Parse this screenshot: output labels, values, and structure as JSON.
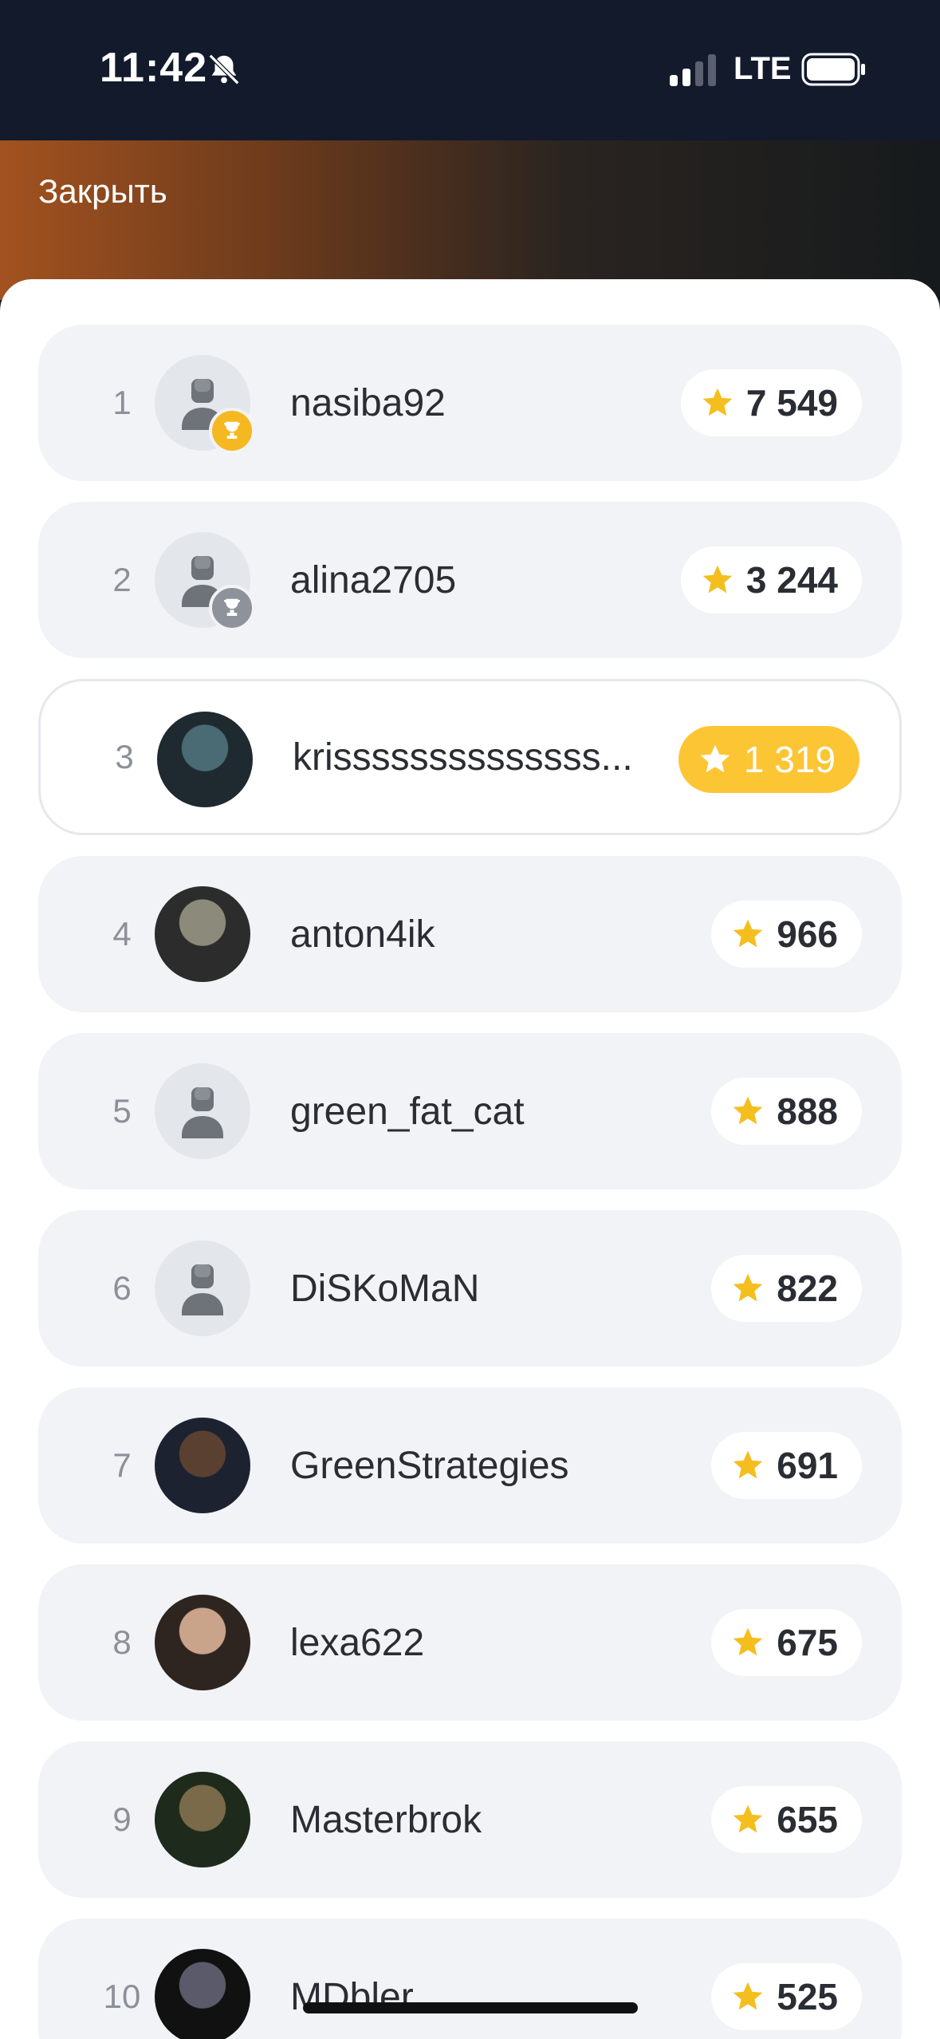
{
  "status": {
    "time": "11:42",
    "network": "LTE"
  },
  "header": {
    "close_label": "Закрыть"
  },
  "leaderboard": [
    {
      "rank": "1",
      "name": "nasiba92",
      "score": "7 549",
      "avatar": "placeholder",
      "badge": "gold-trophy"
    },
    {
      "rank": "2",
      "name": "alina2705",
      "score": "3 244",
      "avatar": "placeholder",
      "badge": "silver-trophy"
    },
    {
      "rank": "3",
      "name": "krissssssssssssss...",
      "score": "1 319",
      "avatar": "photo",
      "highlight": true
    },
    {
      "rank": "4",
      "name": "anton4ik",
      "score": "966",
      "avatar": "photo"
    },
    {
      "rank": "5",
      "name": "green_fat_cat",
      "score": "888",
      "avatar": "placeholder"
    },
    {
      "rank": "6",
      "name": "DiSKoMaN",
      "score": "822",
      "avatar": "placeholder"
    },
    {
      "rank": "7",
      "name": "GreenStrategies",
      "score": "691",
      "avatar": "photo"
    },
    {
      "rank": "8",
      "name": "lexa622",
      "score": "675",
      "avatar": "photo"
    },
    {
      "rank": "9",
      "name": "Masterbrok",
      "score": "655",
      "avatar": "photo"
    },
    {
      "rank": "10",
      "name": "MDbler",
      "score": "525",
      "avatar": "photo"
    }
  ],
  "colors": {
    "accent": "#fcc534",
    "row_bg": "#f1f3f6",
    "star": "#f5be1f"
  }
}
